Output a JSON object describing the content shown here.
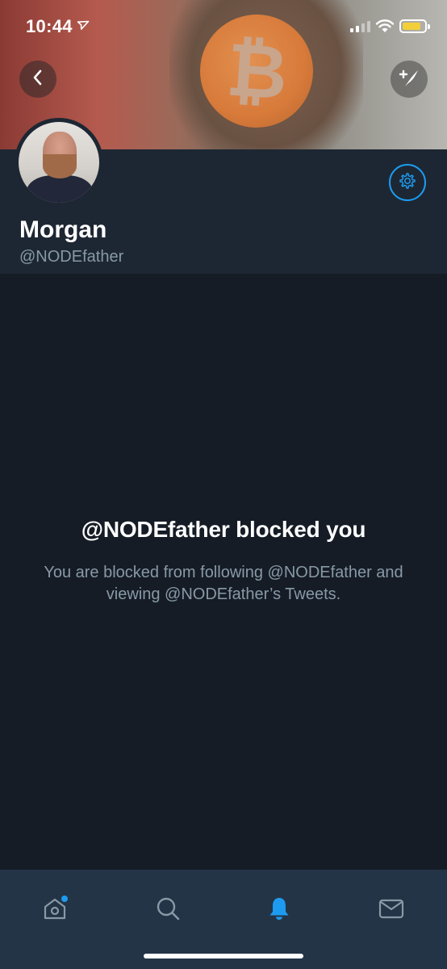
{
  "status_bar": {
    "time": "10:44",
    "location_arrow": "location-arrow-icon",
    "signal_bars_filled": 2,
    "signal_bars_total": 4,
    "battery_color": "#f2cf3a"
  },
  "header": {
    "back_icon": "chevron-left-icon",
    "compose_icon": "compose-feather-icon"
  },
  "profile": {
    "name": "Morgan",
    "handle": "@NODEfather",
    "settings_icon": "gear-icon"
  },
  "main": {
    "blocked_title": "@NODEfather blocked you",
    "blocked_message": "You are blocked from following @NODEfather and viewing @NODEfather’s Tweets."
  },
  "tab_bar": {
    "items": [
      {
        "id": "home",
        "icon": "home-icon",
        "has_badge": true
      },
      {
        "id": "search",
        "icon": "search-icon"
      },
      {
        "id": "notifications",
        "icon": "bell-icon",
        "active": true
      },
      {
        "id": "messages",
        "icon": "envelope-icon"
      }
    ]
  },
  "colors": {
    "accent": "#1d9bf0",
    "background": "#151c26",
    "profile_bg": "#1d2733",
    "tabbar_bg": "#243447",
    "secondary_text": "#8899a6"
  }
}
